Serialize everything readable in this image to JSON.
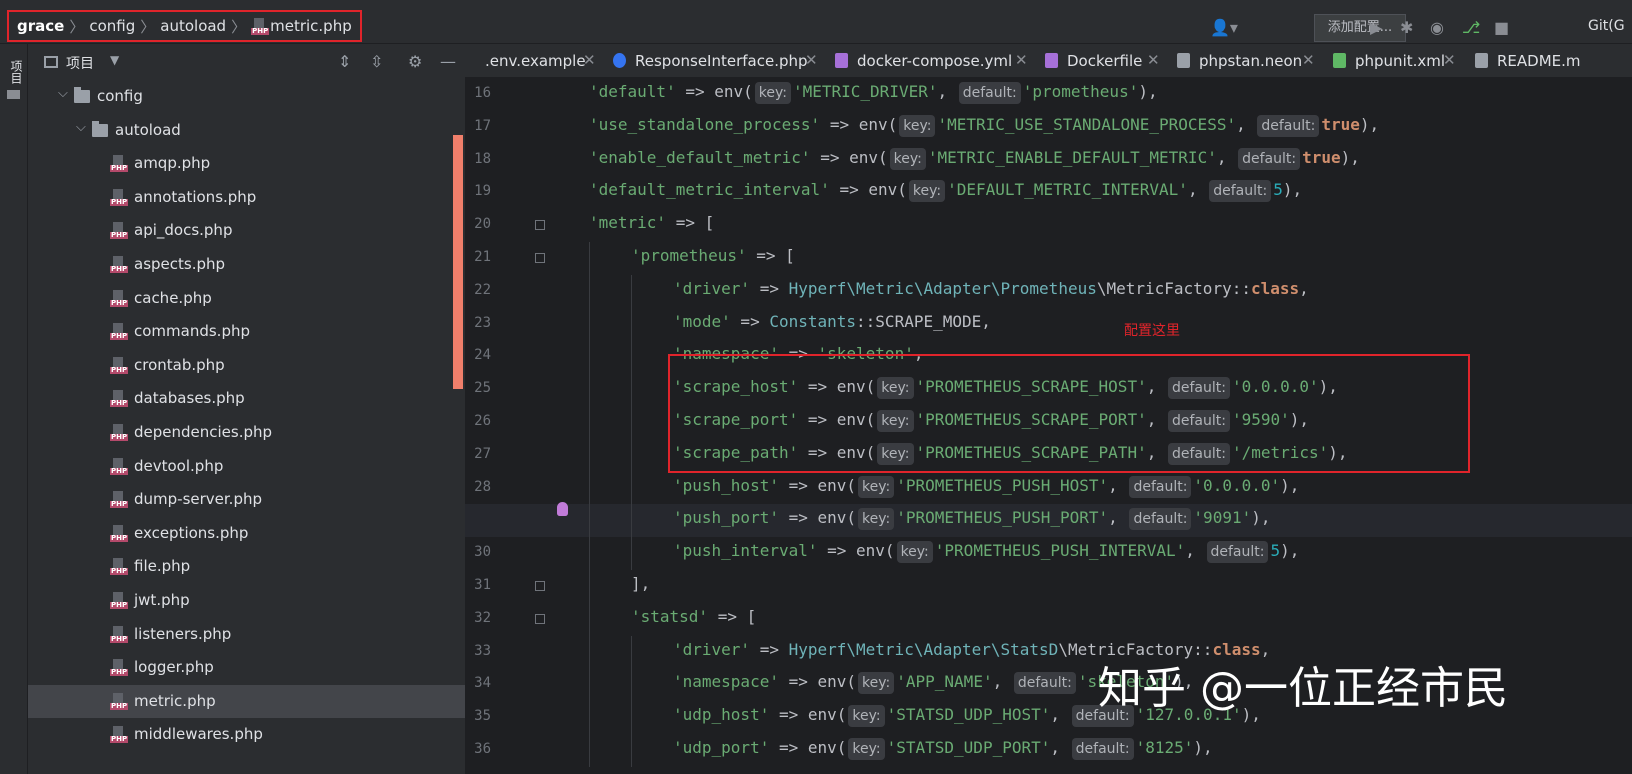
{
  "breadcrumb": {
    "items": [
      "grace",
      "config",
      "autoload",
      "metric.php"
    ]
  },
  "toolbar": {
    "add_config_label": "添加配置...",
    "git_label": "Git(G"
  },
  "side_strip": {
    "label": "项目"
  },
  "project_panel": {
    "title": "项目",
    "tree": [
      {
        "label": "config",
        "type": "folder",
        "depth": 1
      },
      {
        "label": "autoload",
        "type": "folder",
        "depth": 2
      },
      {
        "label": "amqp.php",
        "type": "php",
        "depth": 3
      },
      {
        "label": "annotations.php",
        "type": "php",
        "depth": 3
      },
      {
        "label": "api_docs.php",
        "type": "php",
        "depth": 3
      },
      {
        "label": "aspects.php",
        "type": "php",
        "depth": 3
      },
      {
        "label": "cache.php",
        "type": "php",
        "depth": 3
      },
      {
        "label": "commands.php",
        "type": "php",
        "depth": 3
      },
      {
        "label": "crontab.php",
        "type": "php",
        "depth": 3
      },
      {
        "label": "databases.php",
        "type": "php",
        "depth": 3
      },
      {
        "label": "dependencies.php",
        "type": "php",
        "depth": 3
      },
      {
        "label": "devtool.php",
        "type": "php",
        "depth": 3
      },
      {
        "label": "dump-server.php",
        "type": "php",
        "depth": 3
      },
      {
        "label": "exceptions.php",
        "type": "php",
        "depth": 3
      },
      {
        "label": "file.php",
        "type": "php",
        "depth": 3
      },
      {
        "label": "jwt.php",
        "type": "php",
        "depth": 3
      },
      {
        "label": "listeners.php",
        "type": "php",
        "depth": 3
      },
      {
        "label": "logger.php",
        "type": "php",
        "depth": 3
      },
      {
        "label": "metric.php",
        "type": "php",
        "depth": 3,
        "selected": true
      },
      {
        "label": "middlewares.php",
        "type": "php",
        "depth": 3
      }
    ]
  },
  "tabs": [
    {
      "label": ".env.example",
      "icon": "env-file-icon"
    },
    {
      "label": "ResponseInterface.php",
      "icon": "interface-icon"
    },
    {
      "label": "docker-compose.yml",
      "icon": "docker-compose-icon"
    },
    {
      "label": "Dockerfile",
      "icon": "dockerfile-icon"
    },
    {
      "label": "phpstan.neon",
      "icon": "neon-file-icon"
    },
    {
      "label": "phpunit.xml",
      "icon": "xml-file-icon"
    },
    {
      "label": "README.m",
      "icon": "markdown-icon"
    }
  ],
  "code": {
    "lines": [
      {
        "n": "16",
        "text": "'default' => env( key: 'METRIC_DRIVER',  default: 'prometheus'),"
      },
      {
        "n": "17",
        "text": "'use_standalone_process' => env( key: 'METRIC_USE_STANDALONE_PROCESS',  default: true),"
      },
      {
        "n": "18",
        "text": "'enable_default_metric' => env( key: 'METRIC_ENABLE_DEFAULT_METRIC',  default: true),"
      },
      {
        "n": "19",
        "text": "'default_metric_interval' => env( key: 'DEFAULT_METRIC_INTERVAL',  default: 5),"
      },
      {
        "n": "20",
        "text": "'metric' => ["
      },
      {
        "n": "21",
        "text": "'prometheus' => ["
      },
      {
        "n": "22",
        "text": "'driver' => Hyperf\\Metric\\Adapter\\Prometheus\\MetricFactory::class,"
      },
      {
        "n": "23",
        "text": "'mode' => Constants::SCRAPE_MODE,"
      },
      {
        "n": "24",
        "text": "'namespace' => 'skeleton',"
      },
      {
        "n": "25",
        "text": "'scrape_host' => env( key: 'PROMETHEUS_SCRAPE_HOST',  default: '0.0.0.0'),"
      },
      {
        "n": "26",
        "text": "'scrape_port' => env( key: 'PROMETHEUS_SCRAPE_PORT',  default: '9590'),"
      },
      {
        "n": "27",
        "text": "'scrape_path' => env( key: 'PROMETHEUS_SCRAPE_PATH',  default: '/metrics'),"
      },
      {
        "n": "28",
        "text": "'push_host' => env( key: 'PROMETHEUS_PUSH_HOST',  default: '0.0.0.0'),"
      },
      {
        "n": "29",
        "text": "'push_port' => env( key: 'PROMETHEUS_PUSH_PORT',  default: '9091'),"
      },
      {
        "n": "30",
        "text": "'push_interval' => env( key: 'PROMETHEUS_PUSH_INTERVAL',  default: 5),"
      },
      {
        "n": "31",
        "text": "],"
      },
      {
        "n": "32",
        "text": "'statsd' => ["
      },
      {
        "n": "33",
        "text": "'driver' => Hyperf\\Metric\\Adapter\\StatsD\\MetricFactory::class,"
      },
      {
        "n": "34",
        "text": "'namespace' => env( key: 'APP_NAME',  default: 'skeleton'),"
      },
      {
        "n": "35",
        "text": "'udp_host' => env( key: 'STATSD_UDP_HOST',  default: '127.0.0.1'),"
      },
      {
        "n": "36",
        "text": "'udp_port' => env( key: 'STATSD_UDP_PORT',  default: '8125'),"
      }
    ]
  },
  "annotation": {
    "text": "配置这里"
  },
  "watermark": {
    "text": "知乎 @一位正经市民"
  },
  "colors": {
    "highlight_box": "#e0242b",
    "string": "#6aab73",
    "keyword": "#cf8e6d",
    "namespace": "#6fb3b8",
    "number": "#2aacb8"
  }
}
